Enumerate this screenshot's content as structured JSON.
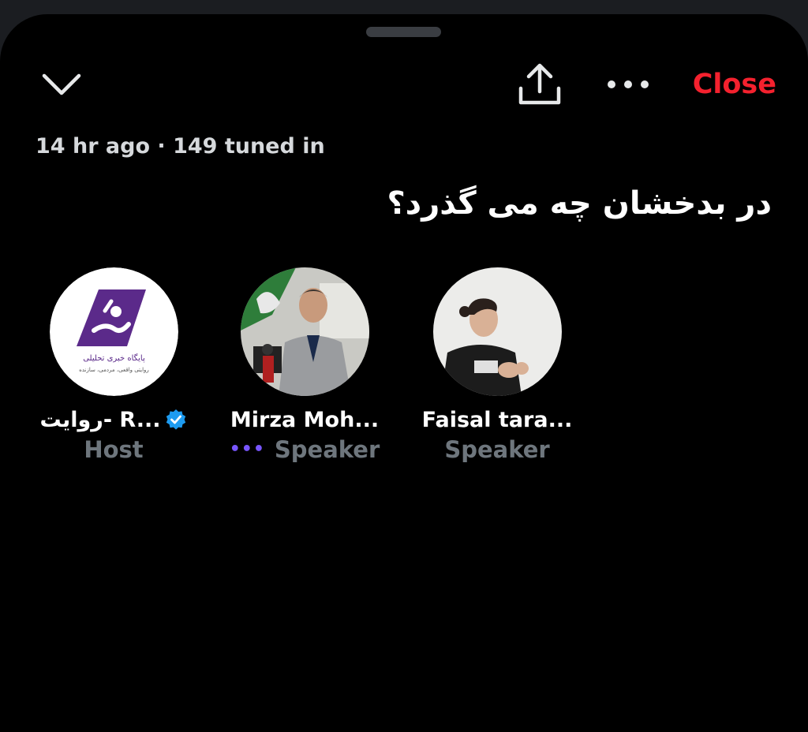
{
  "header": {
    "close_label": "Close"
  },
  "space": {
    "meta": "14 hr ago · 149 tuned in",
    "title": "در بدخشان چه می گذرد؟"
  },
  "participants": [
    {
      "name": "روایت- R...",
      "role": "Host",
      "verified": true,
      "avatar_text_line1": "پایگاه خبری تحلیلی",
      "avatar_text_line2": "روایتی واقعی، مردمی، سازنده"
    },
    {
      "name": "Mirza Moh...",
      "role": "Speaker",
      "speaking_indicator": "•••"
    },
    {
      "name": "Faisal tara...",
      "role": "Speaker"
    }
  ],
  "colors": {
    "accent_close": "#f4212e",
    "verified_blue": "#1d9bf0",
    "speaking_purple": "#7856ff",
    "role_gray": "#6e767d"
  }
}
